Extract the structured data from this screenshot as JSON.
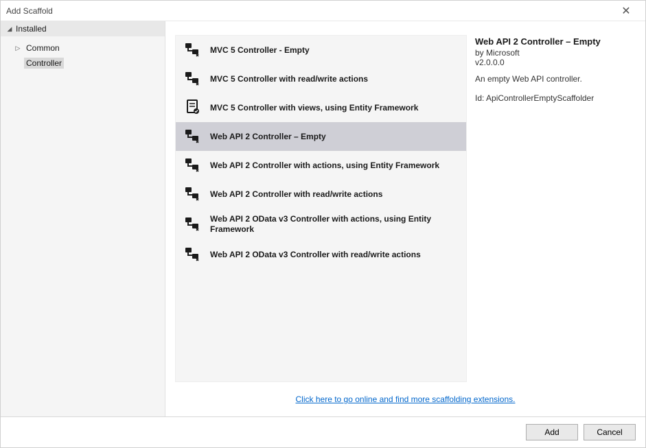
{
  "window": {
    "title": "Add Scaffold"
  },
  "sidebar": {
    "root_label": "Installed",
    "items": [
      {
        "label": "Common",
        "expandable": true,
        "selected": false
      },
      {
        "label": "Controller",
        "expandable": false,
        "selected": true
      }
    ]
  },
  "scaffolds": [
    {
      "label": "MVC 5 Controller - Empty",
      "icon": "controller-icon",
      "selected": false
    },
    {
      "label": "MVC 5 Controller with read/write actions",
      "icon": "controller-icon",
      "selected": false
    },
    {
      "label": "MVC 5 Controller with views, using Entity Framework",
      "icon": "controller-views-icon",
      "selected": false
    },
    {
      "label": "Web API 2 Controller – Empty",
      "icon": "controller-icon",
      "selected": true
    },
    {
      "label": "Web API 2 Controller with actions, using Entity Framework",
      "icon": "controller-icon",
      "selected": false
    },
    {
      "label": "Web API 2 Controller with read/write actions",
      "icon": "controller-icon",
      "selected": false
    },
    {
      "label": "Web API 2 OData v3 Controller with actions, using Entity Framework",
      "icon": "controller-icon",
      "selected": false
    },
    {
      "label": "Web API 2 OData v3 Controller with read/write actions",
      "icon": "controller-icon",
      "selected": false
    }
  ],
  "details": {
    "title": "Web API 2 Controller – Empty",
    "author": "by Microsoft",
    "version": "v2.0.0.0",
    "description": "An empty Web API controller.",
    "id_label": "Id:",
    "id_value": "ApiControllerEmptyScaffolder"
  },
  "online_link": "Click here to go online and find more scaffolding extensions.",
  "buttons": {
    "add": "Add",
    "cancel": "Cancel"
  }
}
